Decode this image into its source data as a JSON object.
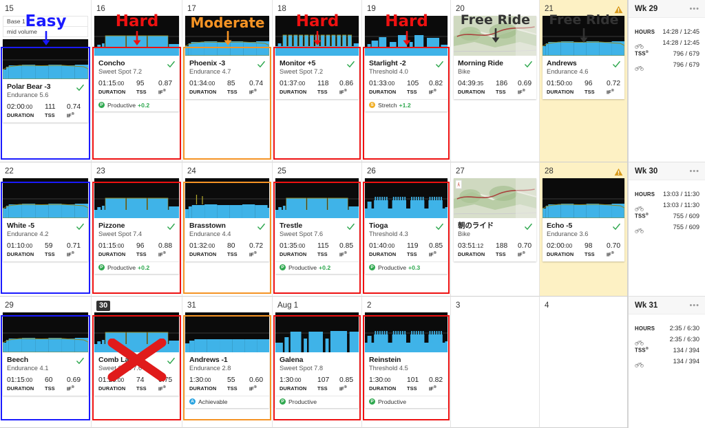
{
  "plan": {
    "block": "Base 1",
    "volume": "mid volume"
  },
  "annotations": [
    {
      "label": "Easy",
      "color": "#1a1aff",
      "day": 15
    },
    {
      "label": "Hard",
      "color": "#ee1111",
      "day": 16
    },
    {
      "label": "Moderate",
      "color": "#f59324",
      "day": 17
    },
    {
      "label": "Hard",
      "color": "#ee1111",
      "day": 18
    },
    {
      "label": "Hard",
      "color": "#ee1111",
      "day": 19
    },
    {
      "label": "Free Ride",
      "color": "#333333",
      "day": 20
    },
    {
      "label": "Free Ride",
      "color": "#333333",
      "day": 21
    }
  ],
  "stat_labels": {
    "duration": "DURATION",
    "tss": "TSS",
    "if": "IF"
  },
  "weeks": [
    {
      "summary": {
        "title": "Wk 29",
        "menu": "•••",
        "rows": [
          {
            "key": "HOURS",
            "value": "14:28 / 12:45"
          },
          {
            "key": "bike",
            "value": "14:28 / 12:45"
          },
          {
            "key": "TSS",
            "value": "796 / 679"
          },
          {
            "key": "bike",
            "value": "796 / 679"
          }
        ]
      },
      "days": [
        {
          "num": "15",
          "today": false,
          "warn": false,
          "highlight": false,
          "plan_header": true,
          "workout": {
            "name": "Polar Bear -3",
            "type": "Endurance 5.6",
            "duration": "02:00",
            "seconds": "00",
            "tss": "111",
            "if": "0.74",
            "done": true,
            "graph": "steady-low",
            "badge": null
          }
        },
        {
          "num": "16",
          "today": false,
          "warn": false,
          "highlight": false,
          "workout": {
            "name": "Concho",
            "type": "Sweet Spot 7.2",
            "duration": "01:15",
            "seconds": "00",
            "tss": "95",
            "if": "0.87",
            "done": true,
            "graph": "sweetspot-blocks",
            "badge": {
              "kind": "productive",
              "text": "Productive",
              "delta": "+0.2"
            }
          }
        },
        {
          "num": "17",
          "today": false,
          "warn": false,
          "highlight": false,
          "workout": {
            "name": "Phoenix -3",
            "type": "Endurance 4.7",
            "duration": "01:34",
            "seconds": "00",
            "tss": "85",
            "if": "0.74",
            "done": true,
            "graph": "steady-low",
            "badge": null
          }
        },
        {
          "num": "18",
          "today": false,
          "warn": false,
          "highlight": false,
          "workout": {
            "name": "Monitor +5",
            "type": "Sweet Spot 7.2",
            "duration": "01:37",
            "seconds": "00",
            "tss": "118",
            "if": "0.86",
            "done": true,
            "graph": "comb",
            "badge": null
          }
        },
        {
          "num": "19",
          "today": false,
          "warn": false,
          "highlight": false,
          "workout": {
            "name": "Starlight -2",
            "type": "Threshold 4.0",
            "duration": "01:33",
            "seconds": "00",
            "tss": "105",
            "if": "0.82",
            "done": true,
            "graph": "threshold-blocks",
            "badge": {
              "kind": "stretch",
              "text": "Stretch",
              "delta": "+1.2"
            }
          }
        },
        {
          "num": "20",
          "today": false,
          "warn": false,
          "highlight": false,
          "workout": {
            "name": "Morning Ride",
            "type": "Bike",
            "duration": "04:39",
            "seconds": "35",
            "tss": "186",
            "if": "0.69",
            "done": true,
            "graph": "map",
            "badge": null
          }
        },
        {
          "num": "21",
          "today": false,
          "warn": true,
          "highlight": true,
          "workout": {
            "name": "Andrews",
            "type": "Endurance 4.6",
            "duration": "01:50",
            "seconds": "00",
            "tss": "96",
            "if": "0.72",
            "done": true,
            "graph": "steady-low",
            "badge": null
          }
        }
      ]
    },
    {
      "summary": {
        "title": "Wk 30",
        "menu": "•••",
        "rows": [
          {
            "key": "HOURS",
            "value": "13:03 / 11:30"
          },
          {
            "key": "bike",
            "value": "13:03 / 11:30"
          },
          {
            "key": "TSS",
            "value": "755 / 609"
          },
          {
            "key": "bike",
            "value": "755 / 609"
          }
        ]
      },
      "days": [
        {
          "num": "22",
          "today": false,
          "warn": false,
          "highlight": false,
          "workout": {
            "name": "White -5",
            "type": "Endurance 4.2",
            "duration": "01:10",
            "seconds": "00",
            "tss": "59",
            "if": "0.71",
            "done": true,
            "graph": "steady-low",
            "badge": null
          }
        },
        {
          "num": "23",
          "today": false,
          "warn": false,
          "highlight": false,
          "workout": {
            "name": "Pizzone",
            "type": "Sweet Spot 7.4",
            "duration": "01:15",
            "seconds": "00",
            "tss": "96",
            "if": "0.88",
            "done": true,
            "graph": "sweetspot-blocks",
            "badge": {
              "kind": "productive",
              "text": "Productive",
              "delta": "+0.2"
            }
          }
        },
        {
          "num": "24",
          "today": false,
          "warn": false,
          "highlight": false,
          "workout": {
            "name": "Brasstown",
            "type": "Endurance 4.4",
            "duration": "01:32",
            "seconds": "00",
            "tss": "80",
            "if": "0.72",
            "done": true,
            "graph": "steady-spikes",
            "badge": null
          }
        },
        {
          "num": "25",
          "today": false,
          "warn": false,
          "highlight": false,
          "workout": {
            "name": "Trestle",
            "type": "Sweet Spot 7.6",
            "duration": "01:35",
            "seconds": "00",
            "tss": "115",
            "if": "0.85",
            "done": true,
            "graph": "sweetspot-blocks",
            "badge": {
              "kind": "productive",
              "text": "Productive",
              "delta": "+0.2"
            }
          }
        },
        {
          "num": "26",
          "today": false,
          "warn": false,
          "highlight": false,
          "workout": {
            "name": "Tioga",
            "type": "Threshold 4.3",
            "duration": "01:40",
            "seconds": "00",
            "tss": "119",
            "if": "0.85",
            "done": true,
            "graph": "intervals-sharp",
            "badge": {
              "kind": "productive",
              "text": "Productive",
              "delta": "+0.3"
            }
          }
        },
        {
          "num": "27",
          "today": false,
          "warn": false,
          "highlight": false,
          "workout": {
            "name": "朝のライド",
            "type": "Bike",
            "duration": "03:51",
            "seconds": "12",
            "tss": "188",
            "if": "0.70",
            "done": true,
            "graph": "map",
            "badge": null
          }
        },
        {
          "num": "28",
          "today": false,
          "warn": true,
          "highlight": true,
          "workout": {
            "name": "Echo -5",
            "type": "Endurance 3.6",
            "duration": "02:00",
            "seconds": "00",
            "tss": "98",
            "if": "0.70",
            "done": true,
            "graph": "steady-low",
            "badge": null
          }
        }
      ]
    },
    {
      "summary": {
        "title": "Wk 31",
        "menu": "•••",
        "rows": [
          {
            "key": "HOURS",
            "value": "2:35 / 6:30"
          },
          {
            "key": "bike",
            "value": "2:35 / 6:30"
          },
          {
            "key": "TSS",
            "value": "134 / 394"
          },
          {
            "key": "bike",
            "value": "134 / 394"
          }
        ]
      },
      "days": [
        {
          "num": "29",
          "today": false,
          "warn": false,
          "highlight": false,
          "workout": {
            "name": "Beech",
            "type": "Endurance 4.1",
            "duration": "01:15",
            "seconds": "00",
            "tss": "60",
            "if": "0.69",
            "done": true,
            "graph": "steady-low",
            "badge": null
          }
        },
        {
          "num": "30",
          "today": true,
          "warn": false,
          "highlight": false,
          "workout": {
            "name": "Comb Law",
            "type": "Sweet Spot 7.6",
            "duration": "01:20",
            "seconds": "00",
            "tss": "74",
            "if": "0.75",
            "done": true,
            "graph": "sweetspot-blocks",
            "badge": null
          }
        },
        {
          "num": "31",
          "today": false,
          "warn": false,
          "highlight": false,
          "workout": {
            "name": "Andrews -1",
            "type": "Endurance 2.8",
            "duration": "1:30",
            "seconds": "00",
            "tss": "55",
            "if": "0.60",
            "done": false,
            "graph": "steady-flat",
            "badge": {
              "kind": "achievable",
              "text": "Achievable",
              "delta": ""
            }
          }
        },
        {
          "num": "Aug 1",
          "today": false,
          "warn": false,
          "highlight": false,
          "workout": {
            "name": "Galena",
            "type": "Sweet Spot 7.8",
            "duration": "1:30",
            "seconds": "00",
            "tss": "107",
            "if": "0.85",
            "done": false,
            "graph": "bigblocks",
            "badge": {
              "kind": "productive",
              "text": "Productive",
              "delta": ""
            }
          }
        },
        {
          "num": "2",
          "today": false,
          "warn": false,
          "highlight": false,
          "workout": {
            "name": "Reinstein",
            "type": "Threshold 4.5",
            "duration": "1:30",
            "seconds": "00",
            "tss": "101",
            "if": "0.82",
            "done": false,
            "graph": "intervals-sharp",
            "badge": {
              "kind": "productive",
              "text": "Productive",
              "delta": ""
            }
          }
        },
        {
          "num": "3",
          "today": false,
          "warn": false,
          "highlight": false,
          "workout": null
        },
        {
          "num": "4",
          "today": false,
          "warn": false,
          "highlight": false,
          "workout": null
        }
      ]
    }
  ],
  "colors": {
    "easy": "#1a1aff",
    "hard": "#ee1111",
    "moderate": "#f59324",
    "free_ride": "#333333",
    "graph_power": "#3fb3e8",
    "graph_bg": "#0b0b0b",
    "highlight_bg": "#fdf1c4",
    "cross_out": "#e01b1b"
  },
  "marks": {
    "cross_out_day": "30",
    "cross_out_glyph": "✕"
  }
}
